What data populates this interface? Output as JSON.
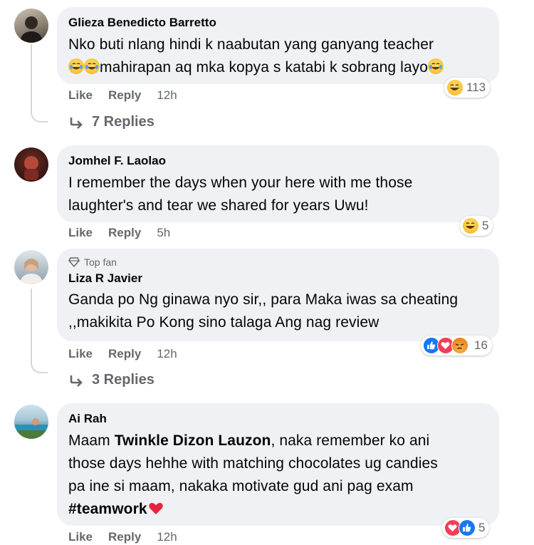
{
  "comments": [
    {
      "author": "Glieza Benedicto Barretto",
      "text_line1": "Nko buti nlang hindi k naabutan yang ganyang teacher",
      "text_line2": "mahirapan aq mka kopya s katabi k sobrang layo",
      "like": "Like",
      "reply": "Reply",
      "time": "12h",
      "reaction_count": "113",
      "reaction_types": [
        "haha"
      ],
      "replies_label": "7 Replies"
    },
    {
      "author": "Jomhel F. Laolao",
      "text_line1": "I remember the days when your here with me those",
      "text_line2": "laughter's and tear we shared for years Uwu!",
      "like": "Like",
      "reply": "Reply",
      "time": "5h",
      "reaction_count": "5",
      "reaction_types": [
        "haha"
      ]
    },
    {
      "badge": "Top fan",
      "author": "Liza R Javier",
      "text_line1": "Ganda po Ng ginawa nyo sir,, para Maka iwas sa cheating",
      "text_line2": ",,makikita Po Kong sino talaga Ang nag review",
      "like": "Like",
      "reply": "Reply",
      "time": "12h",
      "reaction_count": "16",
      "reaction_types": [
        "like",
        "love",
        "angry"
      ],
      "replies_label": "3 Replies"
    },
    {
      "author": "Ai Rah",
      "text_pre": "Maam ",
      "mention": "Twinkle Dizon Lauzon",
      "text_line1_rest": ", naka remember ko ani",
      "text_line2": "those days hehhe with matching chocolates ug candies",
      "text_line3": "pa ine si maam, nakaka motivate gud ani pag exam",
      "hashtag": "#teamwork",
      "like": "Like",
      "reply": "Reply",
      "time": "12h",
      "reaction_count": "5",
      "reaction_types": [
        "love",
        "like"
      ]
    }
  ],
  "colors": {
    "bubble": "#eff1f4",
    "secondary_text": "#65676b",
    "like_blue": "#1877f2",
    "love_red": "#f33e58"
  }
}
